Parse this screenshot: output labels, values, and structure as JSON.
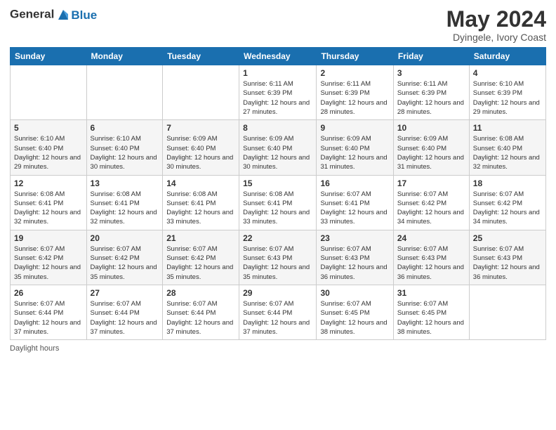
{
  "header": {
    "logo_line1": "General",
    "logo_line2": "Blue",
    "month": "May 2024",
    "location": "Dyingele, Ivory Coast"
  },
  "days_of_week": [
    "Sunday",
    "Monday",
    "Tuesday",
    "Wednesday",
    "Thursday",
    "Friday",
    "Saturday"
  ],
  "footer": {
    "label": "Daylight hours"
  },
  "weeks": [
    [
      {
        "day": "",
        "sunrise": "",
        "sunset": "",
        "daylight": ""
      },
      {
        "day": "",
        "sunrise": "",
        "sunset": "",
        "daylight": ""
      },
      {
        "day": "",
        "sunrise": "",
        "sunset": "",
        "daylight": ""
      },
      {
        "day": "1",
        "sunrise": "Sunrise: 6:11 AM",
        "sunset": "Sunset: 6:39 PM",
        "daylight": "Daylight: 12 hours and 27 minutes."
      },
      {
        "day": "2",
        "sunrise": "Sunrise: 6:11 AM",
        "sunset": "Sunset: 6:39 PM",
        "daylight": "Daylight: 12 hours and 28 minutes."
      },
      {
        "day": "3",
        "sunrise": "Sunrise: 6:11 AM",
        "sunset": "Sunset: 6:39 PM",
        "daylight": "Daylight: 12 hours and 28 minutes."
      },
      {
        "day": "4",
        "sunrise": "Sunrise: 6:10 AM",
        "sunset": "Sunset: 6:39 PM",
        "daylight": "Daylight: 12 hours and 29 minutes."
      }
    ],
    [
      {
        "day": "5",
        "sunrise": "Sunrise: 6:10 AM",
        "sunset": "Sunset: 6:40 PM",
        "daylight": "Daylight: 12 hours and 29 minutes."
      },
      {
        "day": "6",
        "sunrise": "Sunrise: 6:10 AM",
        "sunset": "Sunset: 6:40 PM",
        "daylight": "Daylight: 12 hours and 30 minutes."
      },
      {
        "day": "7",
        "sunrise": "Sunrise: 6:09 AM",
        "sunset": "Sunset: 6:40 PM",
        "daylight": "Daylight: 12 hours and 30 minutes."
      },
      {
        "day": "8",
        "sunrise": "Sunrise: 6:09 AM",
        "sunset": "Sunset: 6:40 PM",
        "daylight": "Daylight: 12 hours and 30 minutes."
      },
      {
        "day": "9",
        "sunrise": "Sunrise: 6:09 AM",
        "sunset": "Sunset: 6:40 PM",
        "daylight": "Daylight: 12 hours and 31 minutes."
      },
      {
        "day": "10",
        "sunrise": "Sunrise: 6:09 AM",
        "sunset": "Sunset: 6:40 PM",
        "daylight": "Daylight: 12 hours and 31 minutes."
      },
      {
        "day": "11",
        "sunrise": "Sunrise: 6:08 AM",
        "sunset": "Sunset: 6:40 PM",
        "daylight": "Daylight: 12 hours and 32 minutes."
      }
    ],
    [
      {
        "day": "12",
        "sunrise": "Sunrise: 6:08 AM",
        "sunset": "Sunset: 6:41 PM",
        "daylight": "Daylight: 12 hours and 32 minutes."
      },
      {
        "day": "13",
        "sunrise": "Sunrise: 6:08 AM",
        "sunset": "Sunset: 6:41 PM",
        "daylight": "Daylight: 12 hours and 32 minutes."
      },
      {
        "day": "14",
        "sunrise": "Sunrise: 6:08 AM",
        "sunset": "Sunset: 6:41 PM",
        "daylight": "Daylight: 12 hours and 33 minutes."
      },
      {
        "day": "15",
        "sunrise": "Sunrise: 6:08 AM",
        "sunset": "Sunset: 6:41 PM",
        "daylight": "Daylight: 12 hours and 33 minutes."
      },
      {
        "day": "16",
        "sunrise": "Sunrise: 6:07 AM",
        "sunset": "Sunset: 6:41 PM",
        "daylight": "Daylight: 12 hours and 33 minutes."
      },
      {
        "day": "17",
        "sunrise": "Sunrise: 6:07 AM",
        "sunset": "Sunset: 6:42 PM",
        "daylight": "Daylight: 12 hours and 34 minutes."
      },
      {
        "day": "18",
        "sunrise": "Sunrise: 6:07 AM",
        "sunset": "Sunset: 6:42 PM",
        "daylight": "Daylight: 12 hours and 34 minutes."
      }
    ],
    [
      {
        "day": "19",
        "sunrise": "Sunrise: 6:07 AM",
        "sunset": "Sunset: 6:42 PM",
        "daylight": "Daylight: 12 hours and 35 minutes."
      },
      {
        "day": "20",
        "sunrise": "Sunrise: 6:07 AM",
        "sunset": "Sunset: 6:42 PM",
        "daylight": "Daylight: 12 hours and 35 minutes."
      },
      {
        "day": "21",
        "sunrise": "Sunrise: 6:07 AM",
        "sunset": "Sunset: 6:42 PM",
        "daylight": "Daylight: 12 hours and 35 minutes."
      },
      {
        "day": "22",
        "sunrise": "Sunrise: 6:07 AM",
        "sunset": "Sunset: 6:43 PM",
        "daylight": "Daylight: 12 hours and 35 minutes."
      },
      {
        "day": "23",
        "sunrise": "Sunrise: 6:07 AM",
        "sunset": "Sunset: 6:43 PM",
        "daylight": "Daylight: 12 hours and 36 minutes."
      },
      {
        "day": "24",
        "sunrise": "Sunrise: 6:07 AM",
        "sunset": "Sunset: 6:43 PM",
        "daylight": "Daylight: 12 hours and 36 minutes."
      },
      {
        "day": "25",
        "sunrise": "Sunrise: 6:07 AM",
        "sunset": "Sunset: 6:43 PM",
        "daylight": "Daylight: 12 hours and 36 minutes."
      }
    ],
    [
      {
        "day": "26",
        "sunrise": "Sunrise: 6:07 AM",
        "sunset": "Sunset: 6:44 PM",
        "daylight": "Daylight: 12 hours and 37 minutes."
      },
      {
        "day": "27",
        "sunrise": "Sunrise: 6:07 AM",
        "sunset": "Sunset: 6:44 PM",
        "daylight": "Daylight: 12 hours and 37 minutes."
      },
      {
        "day": "28",
        "sunrise": "Sunrise: 6:07 AM",
        "sunset": "Sunset: 6:44 PM",
        "daylight": "Daylight: 12 hours and 37 minutes."
      },
      {
        "day": "29",
        "sunrise": "Sunrise: 6:07 AM",
        "sunset": "Sunset: 6:44 PM",
        "daylight": "Daylight: 12 hours and 37 minutes."
      },
      {
        "day": "30",
        "sunrise": "Sunrise: 6:07 AM",
        "sunset": "Sunset: 6:45 PM",
        "daylight": "Daylight: 12 hours and 38 minutes."
      },
      {
        "day": "31",
        "sunrise": "Sunrise: 6:07 AM",
        "sunset": "Sunset: 6:45 PM",
        "daylight": "Daylight: 12 hours and 38 minutes."
      },
      {
        "day": "",
        "sunrise": "",
        "sunset": "",
        "daylight": ""
      }
    ]
  ]
}
